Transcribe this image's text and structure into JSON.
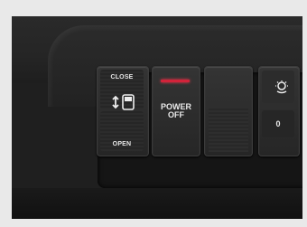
{
  "photo": {
    "subject": "car dashboard switch panel"
  },
  "door_switch": {
    "close_label": "CLOSE",
    "open_label": "OPEN",
    "icon": "sliding-door-icon"
  },
  "power_switch": {
    "label_line1": "POWER",
    "label_line2": "OFF",
    "indicator_color": "#d2233a"
  },
  "blank_switch": {},
  "light_switch": {
    "icon": "interior-light-icon",
    "value": "0"
  }
}
